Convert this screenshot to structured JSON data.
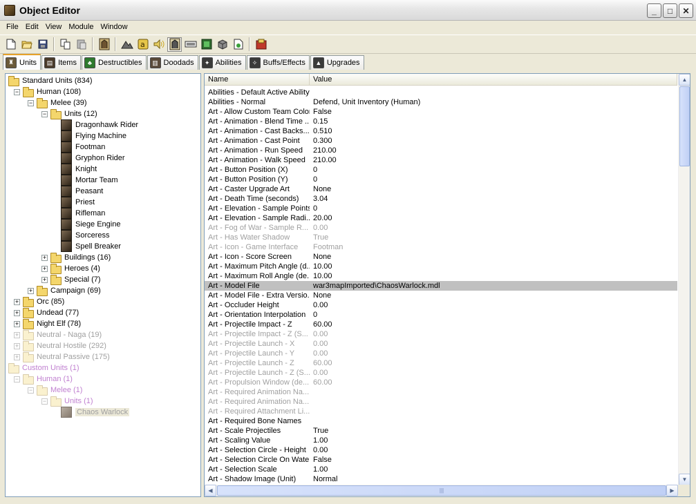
{
  "window": {
    "title": "Object Editor",
    "minimize": "_",
    "maximize": "□",
    "close": "✕"
  },
  "menu": [
    "File",
    "Edit",
    "View",
    "Module",
    "Window"
  ],
  "toolbar": [
    "new-icon",
    "open-icon",
    "save-icon",
    "copy-icon",
    "paste-icon",
    "unit-icon",
    "terrain-icon",
    "text-icon",
    "sound-icon",
    "object-icon",
    "camera-icon",
    "map-icon",
    "cube-icon",
    "export-icon",
    "test-map-icon"
  ],
  "tabs": [
    {
      "label": "Units",
      "icon": "units-icon",
      "active": true,
      "color": "#6b5a3a"
    },
    {
      "label": "Items",
      "icon": "items-icon",
      "active": false,
      "color": "#4a3a2a"
    },
    {
      "label": "Destructibles",
      "icon": "destructibles-icon",
      "active": false,
      "color": "#2e7a2e"
    },
    {
      "label": "Doodads",
      "icon": "doodads-icon",
      "active": false,
      "color": "#5a4a3a"
    },
    {
      "label": "Abilities",
      "icon": "abilities-icon",
      "active": false,
      "color": "#3a3a3a"
    },
    {
      "label": "Buffs/Effects",
      "icon": "buffs-icon",
      "active": false,
      "color": "#3a3a3a"
    },
    {
      "label": "Upgrades",
      "icon": "upgrades-icon",
      "active": false,
      "color": "#3a3a3a"
    }
  ],
  "tree": [
    {
      "label": "Standard Units (834)",
      "level": 0,
      "type": "folder",
      "exp": "",
      "style": ""
    },
    {
      "label": "Human (108)",
      "level": 1,
      "type": "folder",
      "exp": "−",
      "style": ""
    },
    {
      "label": "Melee (39)",
      "level": 2,
      "type": "folder",
      "exp": "−",
      "style": ""
    },
    {
      "label": "Units (12)",
      "level": 3,
      "type": "folder",
      "exp": "−",
      "style": ""
    },
    {
      "label": "Dragonhawk Rider",
      "level": 4,
      "type": "unit",
      "exp": "",
      "style": ""
    },
    {
      "label": "Flying Machine",
      "level": 4,
      "type": "unit",
      "exp": "",
      "style": ""
    },
    {
      "label": "Footman",
      "level": 4,
      "type": "unit",
      "exp": "",
      "style": ""
    },
    {
      "label": "Gryphon Rider",
      "level": 4,
      "type": "unit",
      "exp": "",
      "style": ""
    },
    {
      "label": "Knight",
      "level": 4,
      "type": "unit",
      "exp": "",
      "style": ""
    },
    {
      "label": "Mortar Team",
      "level": 4,
      "type": "unit",
      "exp": "",
      "style": ""
    },
    {
      "label": "Peasant",
      "level": 4,
      "type": "unit",
      "exp": "",
      "style": ""
    },
    {
      "label": "Priest",
      "level": 4,
      "type": "unit",
      "exp": "",
      "style": ""
    },
    {
      "label": "Rifleman",
      "level": 4,
      "type": "unit",
      "exp": "",
      "style": ""
    },
    {
      "label": "Siege Engine",
      "level": 4,
      "type": "unit",
      "exp": "",
      "style": ""
    },
    {
      "label": "Sorceress",
      "level": 4,
      "type": "unit",
      "exp": "",
      "style": ""
    },
    {
      "label": "Spell Breaker",
      "level": 4,
      "type": "unit",
      "exp": "",
      "style": ""
    },
    {
      "label": "Buildings (16)",
      "level": 3,
      "type": "folder",
      "exp": "+",
      "style": ""
    },
    {
      "label": "Heroes (4)",
      "level": 3,
      "type": "folder",
      "exp": "+",
      "style": ""
    },
    {
      "label": "Special (7)",
      "level": 3,
      "type": "folder",
      "exp": "+",
      "style": ""
    },
    {
      "label": "Campaign (69)",
      "level": 2,
      "type": "folder",
      "exp": "+",
      "style": ""
    },
    {
      "label": "Orc (85)",
      "level": 1,
      "type": "folder",
      "exp": "+",
      "style": ""
    },
    {
      "label": "Undead (77)",
      "level": 1,
      "type": "folder",
      "exp": "+",
      "style": ""
    },
    {
      "label": "Night Elf (78)",
      "level": 1,
      "type": "folder",
      "exp": "+",
      "style": ""
    },
    {
      "label": "Neutral - Naga (19)",
      "level": 1,
      "type": "folder",
      "exp": "+",
      "style": "grey"
    },
    {
      "label": "Neutral Hostile (292)",
      "level": 1,
      "type": "folder",
      "exp": "+",
      "style": "grey"
    },
    {
      "label": "Neutral Passive (175)",
      "level": 1,
      "type": "folder",
      "exp": "+",
      "style": "grey"
    },
    {
      "label": "Custom Units (1)",
      "level": 0,
      "type": "folder",
      "exp": "",
      "style": "purple"
    },
    {
      "label": "Human (1)",
      "level": 1,
      "type": "folder",
      "exp": "−",
      "style": "purple"
    },
    {
      "label": "Melee (1)",
      "level": 2,
      "type": "folder",
      "exp": "−",
      "style": "purple"
    },
    {
      "label": "Units (1)",
      "level": 3,
      "type": "folder",
      "exp": "−",
      "style": "purple"
    },
    {
      "label": "Chaos Warlock",
      "level": 4,
      "type": "unit",
      "exp": "",
      "style": "grey",
      "selected": true
    }
  ],
  "grid": {
    "headers": {
      "name": "Name",
      "value": "Value"
    },
    "rows": [
      {
        "name": "Abilities - Default Active Ability",
        "value": "",
        "grey": false
      },
      {
        "name": "Abilities - Normal",
        "value": "Defend, Unit Inventory (Human)",
        "grey": false
      },
      {
        "name": "Art - Allow Custom Team Color",
        "value": "False",
        "grey": false
      },
      {
        "name": "Art - Animation - Blend Time ...",
        "value": "0.15",
        "grey": false
      },
      {
        "name": "Art - Animation - Cast Backs...",
        "value": "0.510",
        "grey": false
      },
      {
        "name": "Art - Animation - Cast Point",
        "value": "0.300",
        "grey": false
      },
      {
        "name": "Art - Animation - Run Speed",
        "value": "210.00",
        "grey": false
      },
      {
        "name": "Art - Animation - Walk Speed",
        "value": "210.00",
        "grey": false
      },
      {
        "name": "Art - Button Position (X)",
        "value": "0",
        "grey": false
      },
      {
        "name": "Art - Button Position (Y)",
        "value": "0",
        "grey": false
      },
      {
        "name": "Art - Caster Upgrade Art",
        "value": "None",
        "grey": false
      },
      {
        "name": "Art - Death Time (seconds)",
        "value": "3.04",
        "grey": false
      },
      {
        "name": "Art - Elevation - Sample Points",
        "value": "0",
        "grey": false
      },
      {
        "name": "Art - Elevation - Sample Radi...",
        "value": "20.00",
        "grey": false
      },
      {
        "name": "Art - Fog of War - Sample R...",
        "value": "0.00",
        "grey": true
      },
      {
        "name": "Art - Has Water Shadow",
        "value": "True",
        "grey": true
      },
      {
        "name": "Art - Icon - Game Interface",
        "value": "Footman",
        "grey": true
      },
      {
        "name": "Art - Icon - Score Screen",
        "value": "None",
        "grey": false
      },
      {
        "name": "Art - Maximum Pitch Angle (d...",
        "value": "10.00",
        "grey": false
      },
      {
        "name": "Art - Maximum Roll Angle (de...",
        "value": "10.00",
        "grey": false
      },
      {
        "name": "Art - Model File",
        "value": "war3mapImported\\ChaosWarlock.mdl",
        "grey": false,
        "selected": true
      },
      {
        "name": "Art - Model File - Extra Versio...",
        "value": "None",
        "grey": false
      },
      {
        "name": "Art - Occluder Height",
        "value": "0.00",
        "grey": false
      },
      {
        "name": "Art - Orientation Interpolation",
        "value": "0",
        "grey": false
      },
      {
        "name": "Art - Projectile Impact - Z",
        "value": "60.00",
        "grey": false
      },
      {
        "name": "Art - Projectile Impact - Z (S...",
        "value": "0.00",
        "grey": true
      },
      {
        "name": "Art - Projectile Launch - X",
        "value": "0.00",
        "grey": true
      },
      {
        "name": "Art - Projectile Launch - Y",
        "value": "0.00",
        "grey": true
      },
      {
        "name": "Art - Projectile Launch - Z",
        "value": "60.00",
        "grey": true
      },
      {
        "name": "Art - Projectile Launch - Z (S...",
        "value": "0.00",
        "grey": true
      },
      {
        "name": "Art - Propulsion Window (de...",
        "value": "60.00",
        "grey": true
      },
      {
        "name": "Art - Required Animation Na...",
        "value": "",
        "grey": true
      },
      {
        "name": "Art - Required Animation Na...",
        "value": "",
        "grey": true
      },
      {
        "name": "Art - Required Attachment Li...",
        "value": "",
        "grey": true
      },
      {
        "name": "Art - Required Bone Names",
        "value": "",
        "grey": false
      },
      {
        "name": "Art - Scale Projectiles",
        "value": "True",
        "grey": false
      },
      {
        "name": "Art - Scaling Value",
        "value": "1.00",
        "grey": false
      },
      {
        "name": "Art - Selection Circle - Height",
        "value": "0.00",
        "grey": false
      },
      {
        "name": "Art - Selection Circle On Water",
        "value": "False",
        "grey": false
      },
      {
        "name": "Art - Selection Scale",
        "value": "1.00",
        "grey": false
      },
      {
        "name": "Art - Shadow Image (Unit)",
        "value": "Normal",
        "grey": false
      }
    ]
  },
  "scroll": {
    "up": "▲",
    "down": "▼",
    "left": "◀",
    "right": "▶",
    "grip": "|||"
  }
}
